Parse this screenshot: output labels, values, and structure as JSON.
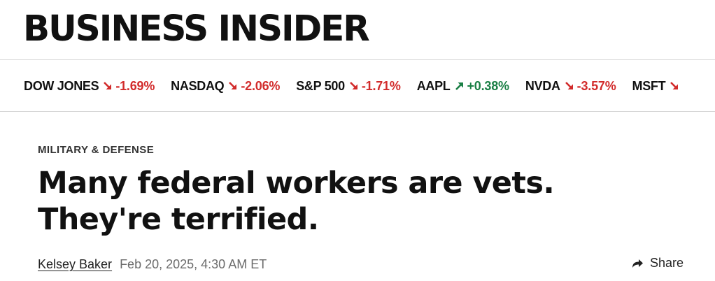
{
  "header": {
    "logo_text": "BUSINESS INSIDER"
  },
  "ticker": {
    "colors": {
      "down": "#d22b2b",
      "up": "#1a7f45"
    },
    "items": [
      {
        "name": "DOW JONES",
        "direction": "down",
        "icon": "arrow-down-right-icon",
        "change": "-1.69%"
      },
      {
        "name": "NASDAQ",
        "direction": "down",
        "icon": "arrow-down-right-icon",
        "change": "-2.06%"
      },
      {
        "name": "S&P 500",
        "direction": "down",
        "icon": "arrow-down-right-icon",
        "change": "-1.71%"
      },
      {
        "name": "AAPL",
        "direction": "up",
        "icon": "arrow-up-right-icon",
        "change": "+0.38%"
      },
      {
        "name": "NVDA",
        "direction": "down",
        "icon": "arrow-down-right-icon",
        "change": "-3.57%"
      },
      {
        "name": "MSFT",
        "direction": "down",
        "icon": "arrow-down-right-icon",
        "change": ""
      }
    ]
  },
  "article": {
    "category": "MILITARY & DEFENSE",
    "headline": "Many federal workers are vets. They're terrified.",
    "author": "Kelsey Baker",
    "timestamp": "Feb 20, 2025, 4:30 AM ET",
    "share_label": "Share",
    "share_icon": "share-arrow-icon"
  }
}
